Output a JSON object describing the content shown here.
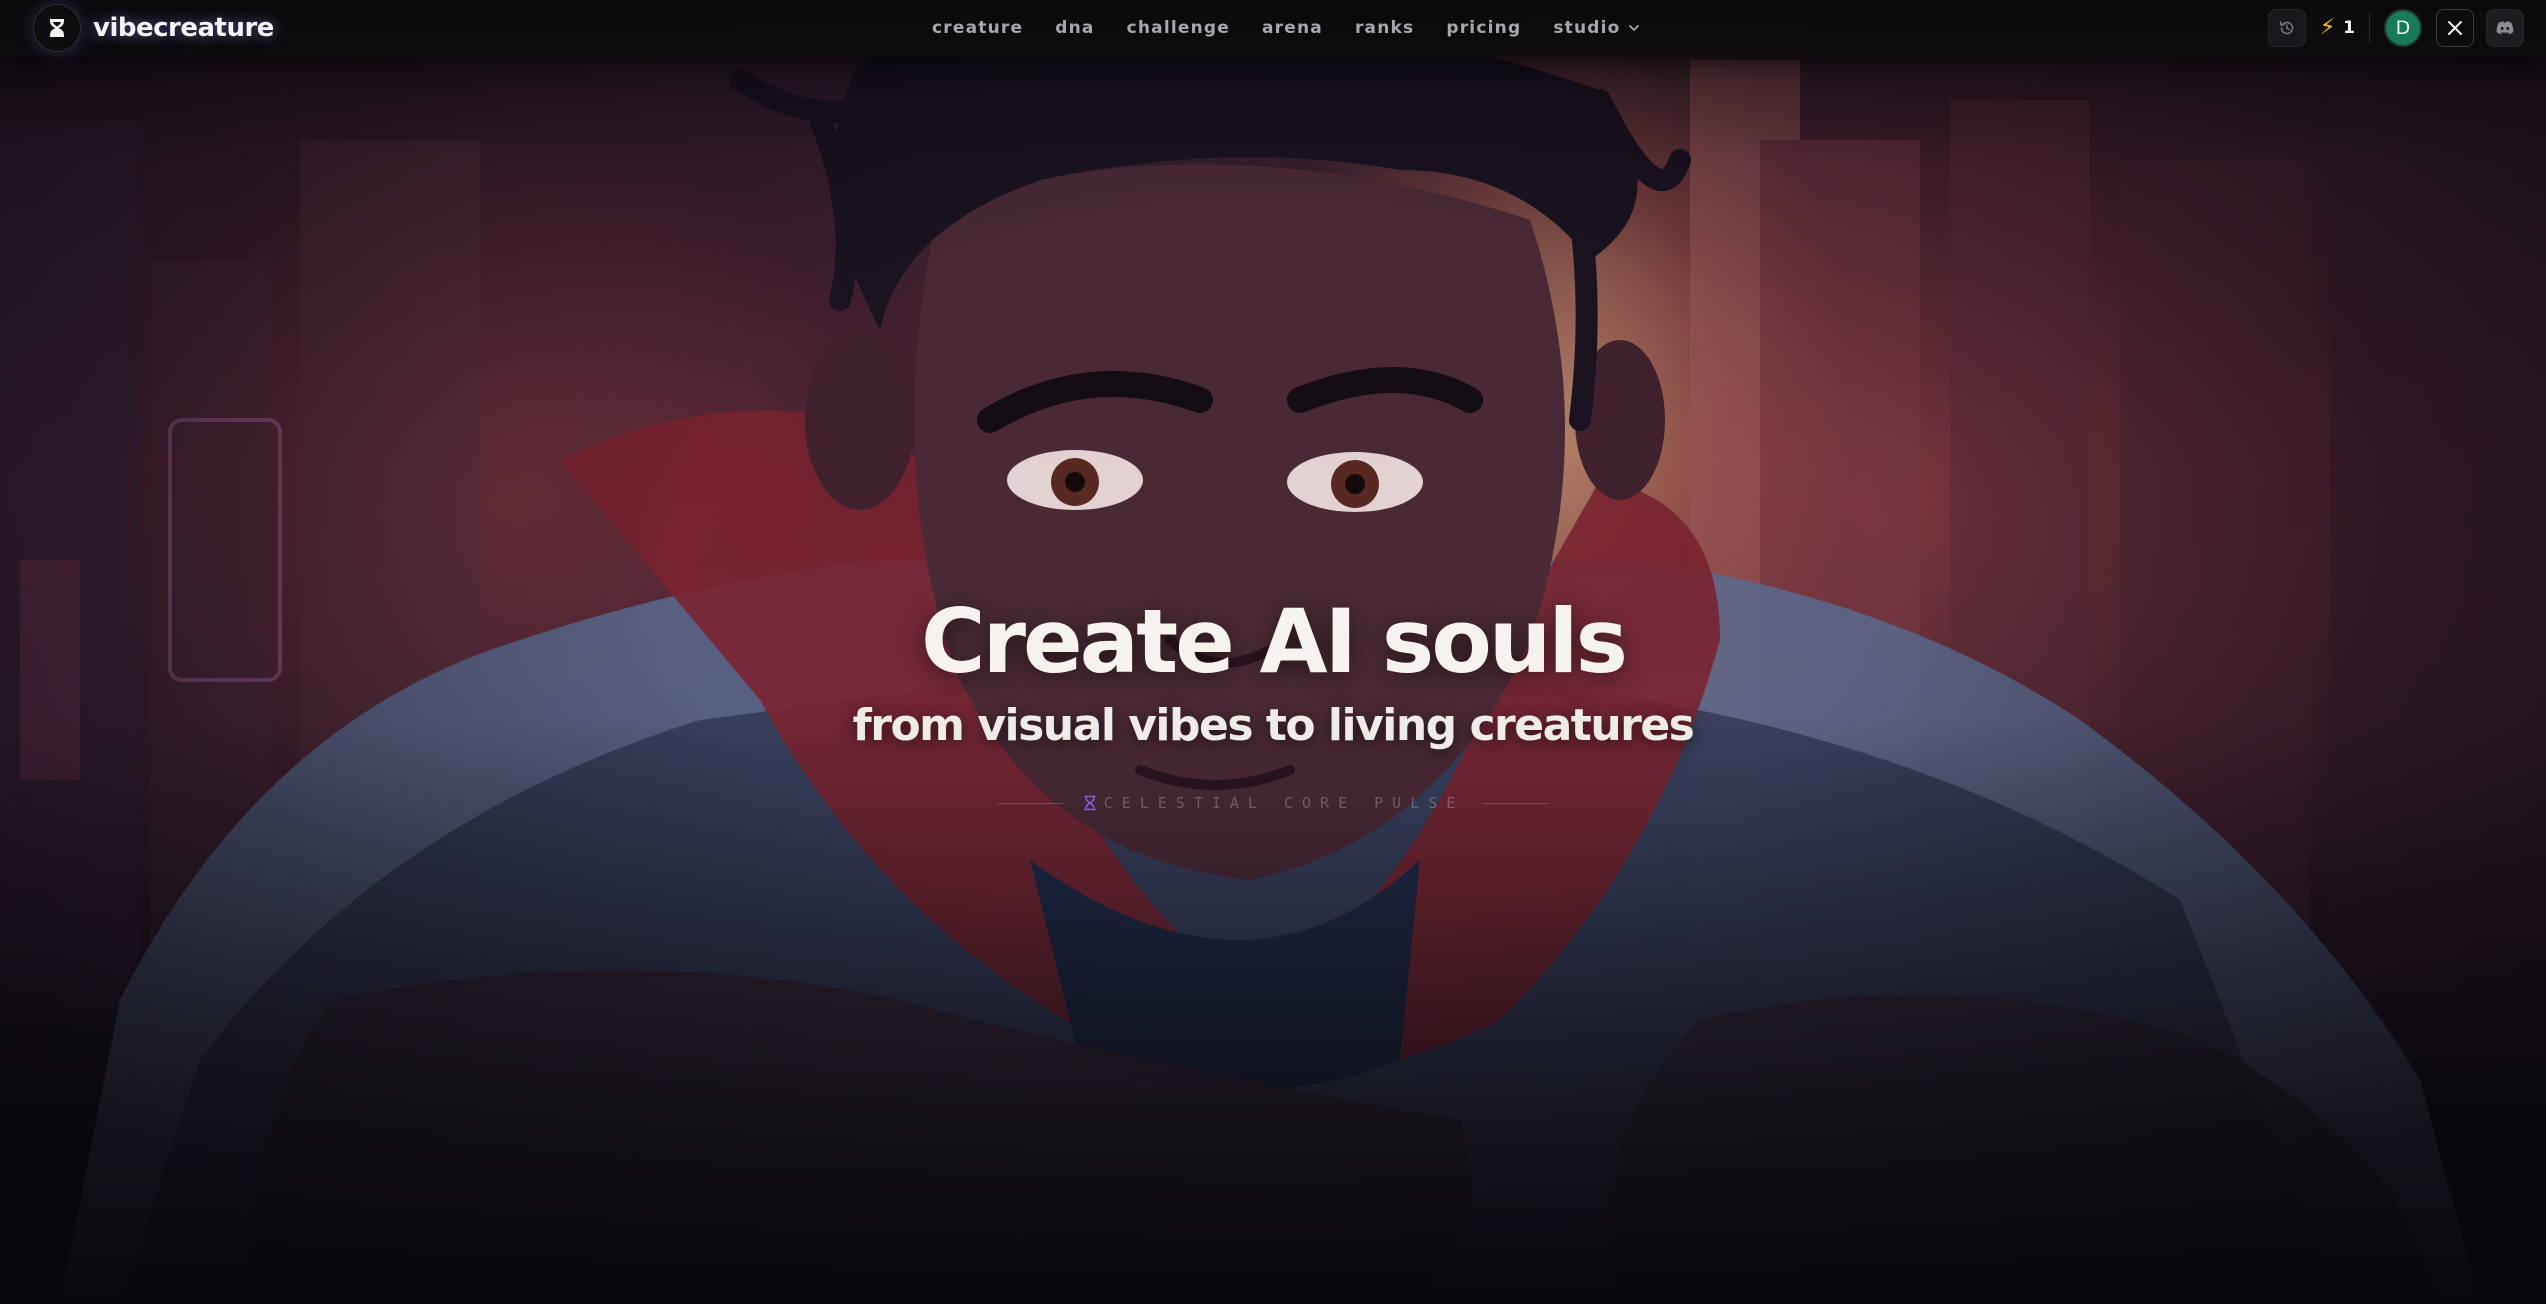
{
  "brand": {
    "name": "vibecreature",
    "logo_icon": "hourglass-logo-icon"
  },
  "nav": {
    "links": [
      {
        "label": "creature"
      },
      {
        "label": "dna"
      },
      {
        "label": "challenge"
      },
      {
        "label": "arena"
      },
      {
        "label": "ranks"
      },
      {
        "label": "pricing"
      },
      {
        "label": "studio",
        "has_dropdown": true
      }
    ]
  },
  "toolbar": {
    "history_icon": "history-icon",
    "credits_icon": "lightning-bolt-icon",
    "credits_count": "1",
    "avatar_initial": "D",
    "x_icon": "x-social-icon",
    "discord_icon": "discord-icon"
  },
  "hero": {
    "title": "Create AI souls",
    "subtitle": "from visual vibes to living creatures",
    "tagline": "celestial core pulse",
    "tagline_icon": "hourglass-icon"
  },
  "colors": {
    "accent_purple": "#a07cff",
    "credits_yellow": "#f5c518",
    "avatar_green": "#167a5b",
    "tagline_icon_purple": "#8f5ad6"
  }
}
